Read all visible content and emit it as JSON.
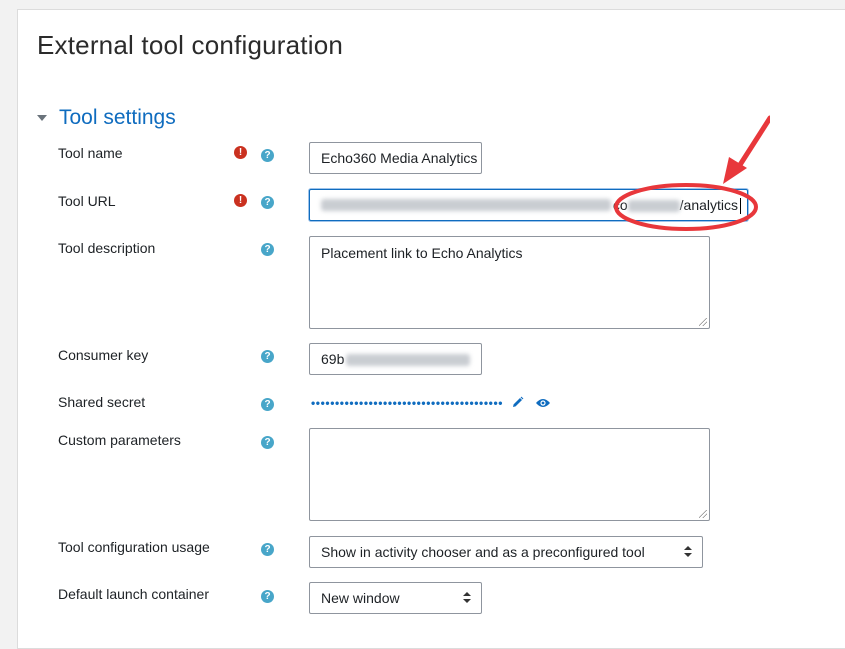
{
  "page": {
    "title": "External tool configuration"
  },
  "section": {
    "title": "Tool settings"
  },
  "fields": {
    "tool_name": {
      "label": "Tool name",
      "value": "Echo360 Media Analytics"
    },
    "tool_url": {
      "label": "Tool URL",
      "value_visible_prefix": "co",
      "value_visible_suffix": "/analytics"
    },
    "tool_description": {
      "label": "Tool description",
      "value": "Placement link to Echo Analytics"
    },
    "consumer_key": {
      "label": "Consumer key",
      "value_visible_prefix": "69b"
    },
    "shared_secret": {
      "label": "Shared secret",
      "masked_value": "••••••••••••••••••••••••••••••••••••••••"
    },
    "custom_parameters": {
      "label": "Custom parameters",
      "value": ""
    },
    "tool_configuration_usage": {
      "label": "Tool configuration usage",
      "selected": "Show in activity chooser and as a preconfigured tool"
    },
    "default_launch_container": {
      "label": "Default launch container",
      "selected": "New window"
    }
  },
  "icons": {
    "required": "exclamation-circle-icon",
    "help": "question-circle-icon",
    "edit": "pencil-icon",
    "reveal": "eye-icon"
  },
  "colors": {
    "accent": "#0f6cbf",
    "required": "#ca3120",
    "help": "#48a6c9",
    "annotation": "#e8373b"
  }
}
